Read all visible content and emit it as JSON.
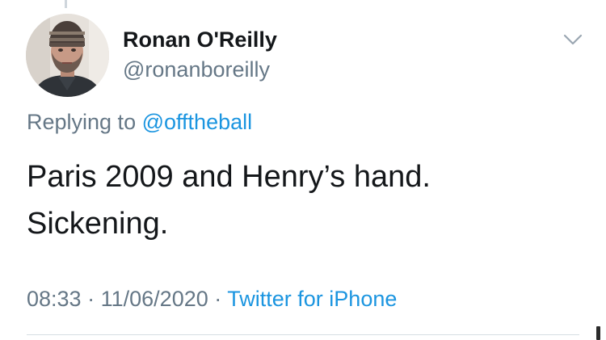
{
  "tweet": {
    "author": {
      "name": "Ronan O'Reilly",
      "handle": "@ronanboreilly"
    },
    "replying_prefix": "Replying to",
    "replying_to": "@offtheball",
    "text_lines": [
      "Paris 2009 and Henry’s hand.",
      "Sickening."
    ],
    "time": "08:33",
    "separator": "·",
    "date": "11/06/2020",
    "source": "Twitter for iPhone"
  },
  "icons": {
    "menu": "chevron-down-icon",
    "avatar": "avatar-photo"
  },
  "colors": {
    "link": "#1b95e0",
    "secondary_text": "#657786",
    "primary_text": "#14171a",
    "divider": "#d6dde3"
  }
}
